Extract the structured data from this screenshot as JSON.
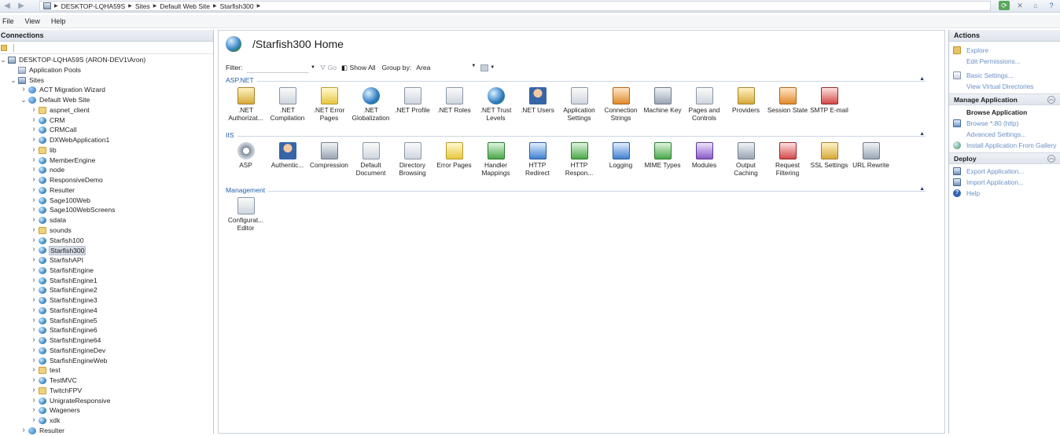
{
  "addressbar": {
    "crumbs": [
      "DESKTOP-LQHA59S",
      "Sites",
      "Default Web Site",
      "Starfish300"
    ]
  },
  "menu": [
    "File",
    "View",
    "Help"
  ],
  "connections": {
    "title": "Connections",
    "tree": [
      {
        "label": "DESKTOP-LQHA59S (ARON-DEV1\\Aron)",
        "level": 0,
        "icon": "server-icon",
        "exp": "open"
      },
      {
        "label": "Application Pools",
        "level": 1,
        "icon": "app-pool-icon",
        "exp": ""
      },
      {
        "label": "Sites",
        "level": 1,
        "icon": "sites-icon",
        "exp": "open"
      },
      {
        "label": "ACT Migration Wizard",
        "level": 2,
        "icon": "site-globe-icon",
        "exp": "closed"
      },
      {
        "label": "Default Web Site",
        "level": 2,
        "icon": "site-globe-icon",
        "exp": "open"
      },
      {
        "label": "aspnet_client",
        "level": 3,
        "icon": "folder-icon",
        "exp": "closed"
      },
      {
        "label": "CRM",
        "level": 3,
        "icon": "application-icon",
        "exp": "closed"
      },
      {
        "label": "CRMCall",
        "level": 3,
        "icon": "application-icon",
        "exp": "closed"
      },
      {
        "label": "DXWebApplication1",
        "level": 3,
        "icon": "application-icon",
        "exp": "closed"
      },
      {
        "label": "lib",
        "level": 3,
        "icon": "folder-icon",
        "exp": "closed"
      },
      {
        "label": "MemberEngine",
        "level": 3,
        "icon": "application-icon",
        "exp": "closed"
      },
      {
        "label": "node",
        "level": 3,
        "icon": "application-icon",
        "exp": "closed"
      },
      {
        "label": "ResponsiveDemo",
        "level": 3,
        "icon": "application-icon",
        "exp": "closed"
      },
      {
        "label": "Resulter",
        "level": 3,
        "icon": "application-icon",
        "exp": "closed"
      },
      {
        "label": "Sage100Web",
        "level": 3,
        "icon": "application-icon",
        "exp": "closed"
      },
      {
        "label": "Sage100WebScreens",
        "level": 3,
        "icon": "application-icon",
        "exp": "closed"
      },
      {
        "label": "sdata",
        "level": 3,
        "icon": "application-icon",
        "exp": "closed"
      },
      {
        "label": "sounds",
        "level": 3,
        "icon": "folder-icon",
        "exp": "closed"
      },
      {
        "label": "Starfish100",
        "level": 3,
        "icon": "application-icon",
        "exp": "closed"
      },
      {
        "label": "Starfish300",
        "level": 3,
        "icon": "application-icon",
        "exp": "closed",
        "selected": true
      },
      {
        "label": "StarfishAPI",
        "level": 3,
        "icon": "application-icon",
        "exp": "closed"
      },
      {
        "label": "StarfishEngine",
        "level": 3,
        "icon": "application-icon",
        "exp": "closed"
      },
      {
        "label": "StarfishEngine1",
        "level": 3,
        "icon": "application-icon",
        "exp": "closed"
      },
      {
        "label": "StarfishEngine2",
        "level": 3,
        "icon": "application-icon",
        "exp": "closed"
      },
      {
        "label": "StarfishEngine3",
        "level": 3,
        "icon": "application-icon",
        "exp": "closed"
      },
      {
        "label": "StarfishEngine4",
        "level": 3,
        "icon": "application-icon",
        "exp": "closed"
      },
      {
        "label": "StarfishEngine5",
        "level": 3,
        "icon": "application-icon",
        "exp": "closed"
      },
      {
        "label": "StarfishEngine6",
        "level": 3,
        "icon": "application-icon",
        "exp": "closed"
      },
      {
        "label": "StarfishEngine64",
        "level": 3,
        "icon": "application-icon",
        "exp": "closed"
      },
      {
        "label": "StarfishEngineDev",
        "level": 3,
        "icon": "application-icon",
        "exp": "closed"
      },
      {
        "label": "StarfishEngineWeb",
        "level": 3,
        "icon": "application-icon",
        "exp": "closed"
      },
      {
        "label": "test",
        "level": 3,
        "icon": "folder-icon",
        "exp": "closed"
      },
      {
        "label": "TestMVC",
        "level": 3,
        "icon": "application-icon",
        "exp": "closed"
      },
      {
        "label": "TwitchFPV",
        "level": 3,
        "icon": "folder-icon",
        "exp": "closed"
      },
      {
        "label": "UnigrateResponsive",
        "level": 3,
        "icon": "application-icon",
        "exp": "closed"
      },
      {
        "label": "Wageners",
        "level": 3,
        "icon": "application-icon",
        "exp": "closed"
      },
      {
        "label": "xdk",
        "level": 3,
        "icon": "application-icon",
        "exp": "closed"
      },
      {
        "label": "Resulter",
        "level": 2,
        "icon": "site-globe-icon",
        "exp": "closed"
      }
    ]
  },
  "main": {
    "title": "/Starfish300 Home",
    "filter": {
      "label": "Filter:",
      "value": "",
      "go": "Go",
      "show_all": "Show All",
      "group_by_label": "Group by:",
      "group_by_value": "Area"
    },
    "sections": [
      {
        "name": "ASP.NET",
        "features": [
          {
            "label": ".NET Authorizat...",
            "icon": "lock-icon"
          },
          {
            "label": ".NET Compilation",
            "icon": "compilation-icon"
          },
          {
            "label": ".NET Error Pages",
            "icon": "error-page-icon"
          },
          {
            "label": ".NET Globalization",
            "icon": "globe-icon"
          },
          {
            "label": ".NET Profile",
            "icon": "profile-icon"
          },
          {
            "label": ".NET Roles",
            "icon": "roles-icon"
          },
          {
            "label": ".NET Trust Levels",
            "icon": "trust-icon"
          },
          {
            "label": ".NET Users",
            "icon": "users-icon"
          },
          {
            "label": "Application Settings",
            "icon": "app-settings-icon"
          },
          {
            "label": "Connection Strings",
            "icon": "connection-strings-icon"
          },
          {
            "label": "Machine Key",
            "icon": "machine-key-icon"
          },
          {
            "label": "Pages and Controls",
            "icon": "pages-icon"
          },
          {
            "label": "Providers",
            "icon": "providers-icon"
          },
          {
            "label": "Session State",
            "icon": "session-icon"
          },
          {
            "label": "SMTP E-mail",
            "icon": "email-icon"
          }
        ]
      },
      {
        "name": "IIS",
        "features": [
          {
            "label": "ASP",
            "icon": "asp-icon"
          },
          {
            "label": "Authentic...",
            "icon": "authentication-icon"
          },
          {
            "label": "Compression",
            "icon": "compression-icon"
          },
          {
            "label": "Default Document",
            "icon": "default-document-icon"
          },
          {
            "label": "Directory Browsing",
            "icon": "directory-icon"
          },
          {
            "label": "Error Pages",
            "icon": "error-pages-icon"
          },
          {
            "label": "Handler Mappings",
            "icon": "handler-icon"
          },
          {
            "label": "HTTP Redirect",
            "icon": "redirect-icon"
          },
          {
            "label": "HTTP Respon...",
            "icon": "response-icon"
          },
          {
            "label": "Logging",
            "icon": "logging-icon"
          },
          {
            "label": "MIME Types",
            "icon": "mime-icon"
          },
          {
            "label": "Modules",
            "icon": "modules-icon"
          },
          {
            "label": "Output Caching",
            "icon": "output-caching-icon"
          },
          {
            "label": "Request Filtering",
            "icon": "request-filtering-icon"
          },
          {
            "label": "SSL Settings",
            "icon": "ssl-lock-icon"
          },
          {
            "label": "URL Rewrite",
            "icon": "url-rewrite-icon"
          }
        ]
      },
      {
        "name": "Management",
        "features": [
          {
            "label": "Configurat... Editor",
            "icon": "config-editor-icon"
          }
        ]
      }
    ]
  },
  "actions": {
    "title": "Actions",
    "top": [
      {
        "label": "Explore",
        "icon": "explore-icon"
      },
      {
        "label": "Edit Permissions...",
        "icon": ""
      },
      {
        "label": "Basic Settings...",
        "icon": "settings-icon"
      },
      {
        "label": "View Virtual Directories",
        "icon": ""
      }
    ],
    "manage": {
      "title": "Manage Application",
      "items": [
        {
          "label": "Browse Application",
          "bold": true,
          "icon": ""
        },
        {
          "label": "Browse *:80 (http)",
          "icon": "browse-icon"
        },
        {
          "label": "Advanced Settings...",
          "icon": ""
        },
        {
          "label": "Install Application From Gallery",
          "icon": "install-icon"
        }
      ]
    },
    "deploy": {
      "title": "Deploy",
      "items": [
        {
          "label": "Export Application...",
          "icon": "export-icon"
        },
        {
          "label": "Import Application...",
          "icon": "import-icon"
        },
        {
          "label": "Help",
          "icon": "help-icon"
        }
      ]
    }
  }
}
